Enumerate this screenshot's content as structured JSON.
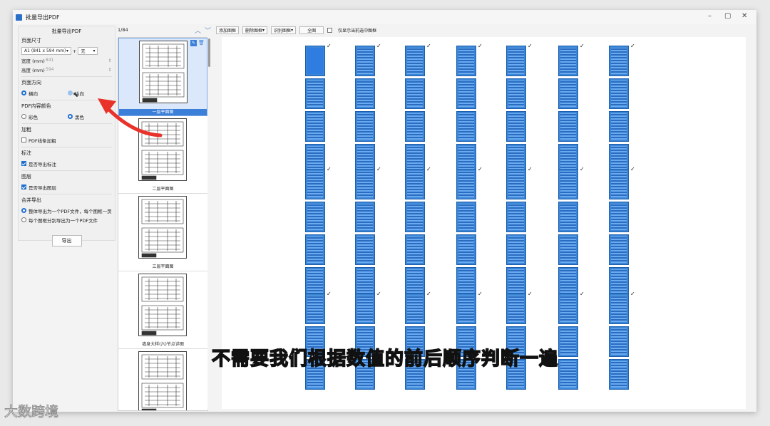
{
  "window": {
    "title": "批量导出PDF",
    "minimize": "–",
    "restore": "▢",
    "close": "✕"
  },
  "left": {
    "panel_title": "批量导出PDF",
    "page_size": {
      "title": "页面尺寸",
      "size_value": "A1 (841 x 594 mm)",
      "plus": "+",
      "extra_value": "无",
      "width_label": "宽度 (mm)",
      "width_value": "841",
      "height_label": "高度 (mm)",
      "height_value": "594"
    },
    "orientation": {
      "title": "页面方向",
      "landscape": "横向",
      "portrait": "纵向"
    },
    "color": {
      "title": "PDF内容颜色",
      "color": "彩色",
      "black": "黑色"
    },
    "bold": {
      "title": "加粗",
      "label": "PDF线条加粗"
    },
    "annotation": {
      "title": "标注",
      "label": "是否导出标注"
    },
    "layer": {
      "title": "图层",
      "label": "是否导出图层"
    },
    "merge": {
      "title": "合并导出",
      "opt1": "整体导出为一个PDF文件，每个图框一页",
      "opt2": "每个图框分别导出为一个PDF文件"
    },
    "export_label": "导出"
  },
  "mid": {
    "counter": "1/84",
    "thumbs": [
      {
        "caption": "一层平面图"
      },
      {
        "caption": "二层平面图"
      },
      {
        "caption": "三层平面图"
      },
      {
        "caption": "墙身大样(六)节点详图"
      },
      {
        "caption": ""
      }
    ]
  },
  "toolbar": {
    "add": "添加图框",
    "delete": "删除图框",
    "recognize": "识别图框",
    "fit": "全图",
    "only_selected": "仅显示当前选中图框"
  },
  "subtitle": "不需要我们根据数值的前后顺序判断一遍",
  "watermark": "大数跨境"
}
